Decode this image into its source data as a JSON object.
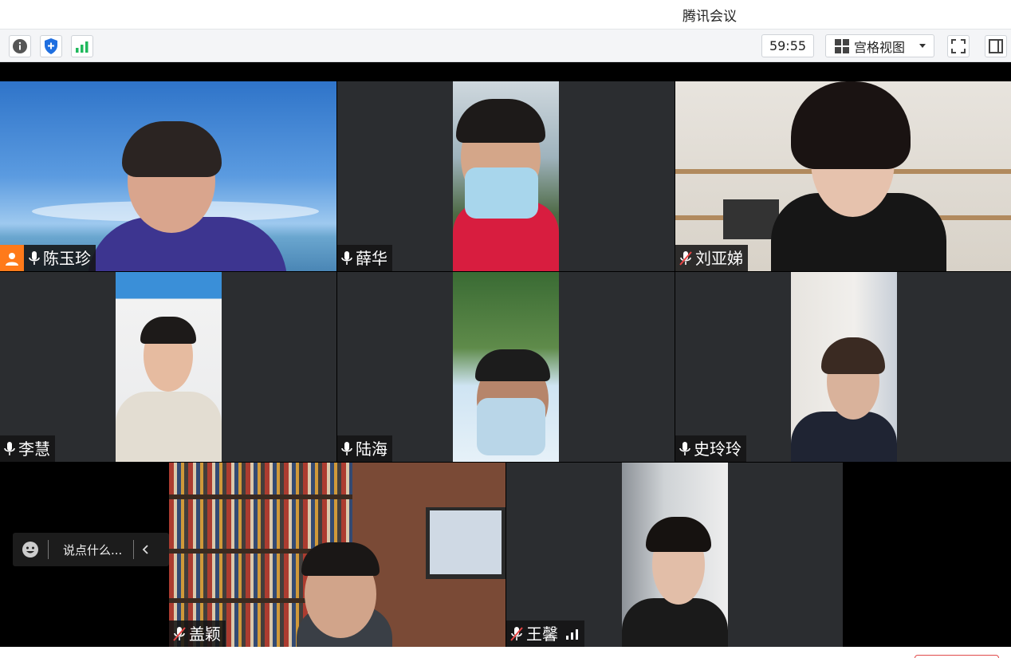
{
  "window": {
    "title": "腾讯会议"
  },
  "toolbar": {
    "info_icon": "info-icon",
    "security_icon": "shield-icon",
    "network_icon": "signal-bars-icon",
    "timer": "59:55",
    "view_mode": "宫格视图",
    "fullscreen_icon": "fullscreen-icon",
    "sidebar_icon": "sidebar-toggle-icon"
  },
  "participants": [
    {
      "name": "陈玉珍",
      "mic": "on",
      "host": true,
      "active_speaker": true
    },
    {
      "name": "薛华",
      "mic": "on"
    },
    {
      "name": "刘亚娣",
      "mic": "muted"
    },
    {
      "name": "李慧",
      "mic": "on"
    },
    {
      "name": "陆海",
      "mic": "on"
    },
    {
      "name": "史玲玲",
      "mic": "on"
    },
    {
      "name": "盖颖",
      "mic": "muted"
    },
    {
      "name": "王馨",
      "mic": "muted",
      "signal": true
    }
  ],
  "chat": {
    "placeholder": "说点什么..."
  },
  "colors": {
    "accent_green": "#26c281",
    "host_orange": "#ff7a1a",
    "tile_bg": "#2b2d30",
    "leave_red": "#e14b4b"
  }
}
